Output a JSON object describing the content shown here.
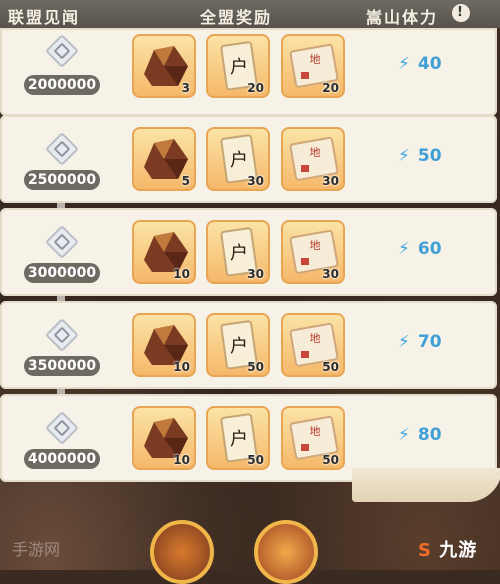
{
  "header": {
    "left_label": "联盟见闻",
    "center_label": "全盟奖励",
    "right_label": "嵩山体力"
  },
  "rows": [
    {
      "milestone": "2000000",
      "items": [
        {
          "icon": "ore-icon",
          "qty": "3"
        },
        {
          "icon": "household-register-icon",
          "qty": "20"
        },
        {
          "icon": "map-scroll-icon",
          "qty": "20"
        }
      ],
      "energy": "40"
    },
    {
      "milestone": "2500000",
      "items": [
        {
          "icon": "ore-icon",
          "qty": "5"
        },
        {
          "icon": "household-register-icon",
          "qty": "30"
        },
        {
          "icon": "map-scroll-icon",
          "qty": "30"
        }
      ],
      "energy": "50"
    },
    {
      "milestone": "3000000",
      "items": [
        {
          "icon": "ore-icon",
          "qty": "10"
        },
        {
          "icon": "household-register-icon",
          "qty": "30"
        },
        {
          "icon": "map-scroll-icon",
          "qty": "30"
        }
      ],
      "energy": "60"
    },
    {
      "milestone": "3500000",
      "items": [
        {
          "icon": "ore-icon",
          "qty": "10"
        },
        {
          "icon": "household-register-icon",
          "qty": "50"
        },
        {
          "icon": "map-scroll-icon",
          "qty": "50"
        }
      ],
      "energy": "70"
    },
    {
      "milestone": "4000000",
      "items": [
        {
          "icon": "ore-icon",
          "qty": "10"
        },
        {
          "icon": "household-register-icon",
          "qty": "50"
        },
        {
          "icon": "map-scroll-icon",
          "qty": "50"
        }
      ],
      "energy": "80"
    }
  ],
  "item_glyphs": {
    "household_register_char": "户",
    "map_char": "地"
  },
  "brand": {
    "mark": "S",
    "text": "九游"
  },
  "watermark": "手游网"
}
